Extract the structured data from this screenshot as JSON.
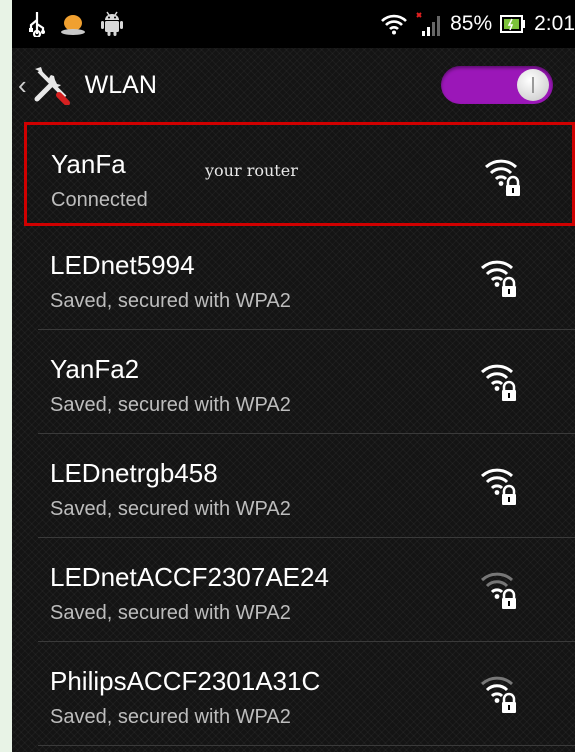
{
  "status_bar": {
    "battery_percent": "85%",
    "time": "2:01",
    "left_icons": [
      "usb-icon",
      "notification-icon",
      "android-icon"
    ],
    "right_icons": [
      "wifi-icon",
      "signal-icon",
      "battery-icon"
    ]
  },
  "action_bar": {
    "title": "WLAN",
    "toggle_on": true,
    "toggle_color": "#9b17b8"
  },
  "annotation": {
    "text": "your router",
    "highlight_color": "#d00000"
  },
  "networks": [
    {
      "name": "YanFa",
      "status": "Connected",
      "signal": "strong",
      "secured": true
    },
    {
      "name": "LEDnet5994",
      "status": "Saved, secured with WPA2",
      "signal": "strong",
      "secured": true
    },
    {
      "name": "YanFa2",
      "status": "Saved, secured with WPA2",
      "signal": "strong",
      "secured": true
    },
    {
      "name": "LEDnetrgb458",
      "status": "Saved, secured with WPA2",
      "signal": "strong",
      "secured": true
    },
    {
      "name": "LEDnetACCF2307AE24",
      "status": "Saved, secured with WPA2",
      "signal": "weak",
      "secured": true
    },
    {
      "name": "PhilipsACCF2301A31C",
      "status": "Saved, secured with WPA2",
      "signal": "medium",
      "secured": true
    }
  ]
}
